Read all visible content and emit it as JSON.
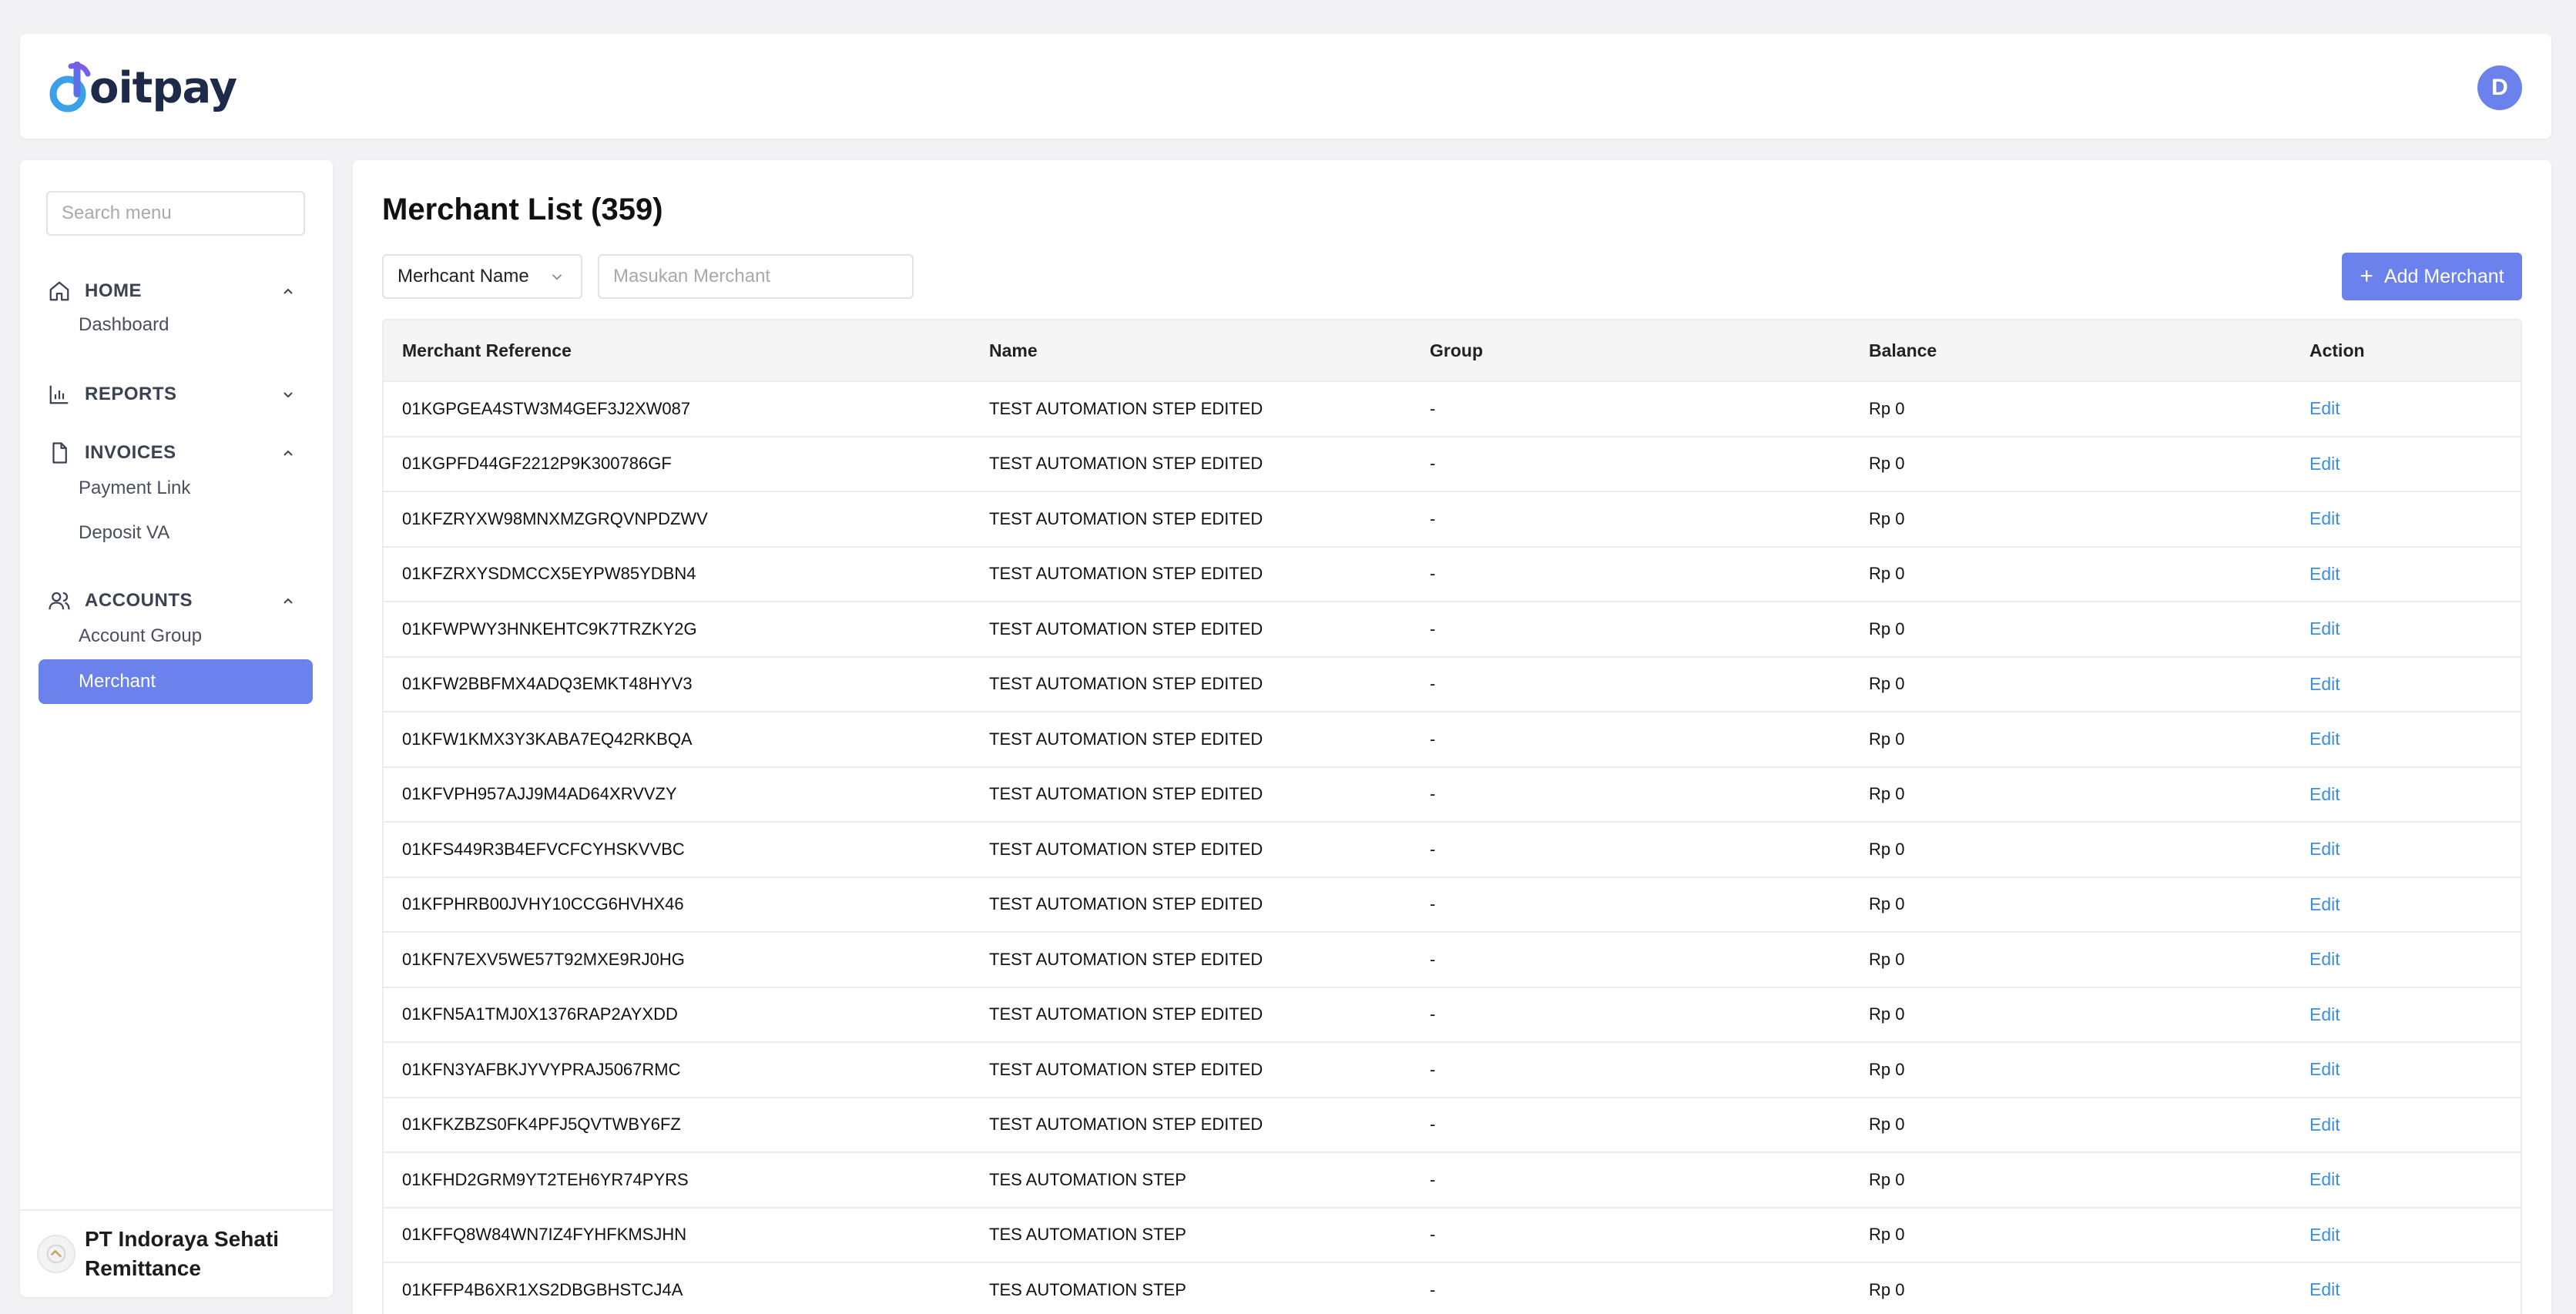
{
  "brand": {
    "logo_text": "oitpay",
    "accent": "#6b82ec"
  },
  "user": {
    "avatar_initial": "D"
  },
  "sidebar": {
    "search_placeholder": "Search menu",
    "sections": [
      {
        "label": "HOME",
        "icon": "home-icon",
        "expanded": true,
        "items": [
          "Dashboard"
        ]
      },
      {
        "label": "REPORTS",
        "icon": "bar-chart-icon",
        "expanded": false,
        "items": []
      },
      {
        "label": "INVOICES",
        "icon": "document-icon",
        "expanded": true,
        "items": [
          "Payment Link",
          "Deposit VA"
        ]
      },
      {
        "label": "ACCOUNTS",
        "icon": "users-icon",
        "expanded": true,
        "items": [
          "Account Group",
          "Merchant"
        ]
      }
    ],
    "active_item": "Merchant",
    "company_name_line1": "PT Indoraya Sehati",
    "company_name_line2": "Remittance"
  },
  "main": {
    "title": "Merchant List (359)",
    "filter_select": "Merhcant Name",
    "filter_placeholder": "Masukan Merchant",
    "add_button": "Add Merchant",
    "columns": [
      "Merchant Reference",
      "Name",
      "Group",
      "Balance",
      "Action"
    ],
    "rows": [
      [
        "01KGPGEA4STW3M4GEF3J2XW087",
        "TEST AUTOMATION STEP EDITED",
        "-",
        "Rp 0",
        "Edit"
      ],
      [
        "01KGPFD44GF2212P9K300786GF",
        "TEST AUTOMATION STEP EDITED",
        "-",
        "Rp 0",
        "Edit"
      ],
      [
        "01KFZRYXW98MNXMZGRQVNPDZWV",
        "TEST AUTOMATION STEP EDITED",
        "-",
        "Rp 0",
        "Edit"
      ],
      [
        "01KFZRXYSDMCCX5EYPW85YDBN4",
        "TEST AUTOMATION STEP EDITED",
        "-",
        "Rp 0",
        "Edit"
      ],
      [
        "01KFWPWY3HNKEHTC9K7TRZKY2G",
        "TEST AUTOMATION STEP EDITED",
        "-",
        "Rp 0",
        "Edit"
      ],
      [
        "01KFW2BBFMX4ADQ3EMKT48HYV3",
        "TEST AUTOMATION STEP EDITED",
        "-",
        "Rp 0",
        "Edit"
      ],
      [
        "01KFW1KMX3Y3KABA7EQ42RKBQA",
        "TEST AUTOMATION STEP EDITED",
        "-",
        "Rp 0",
        "Edit"
      ],
      [
        "01KFVPH957AJJ9M4AD64XRVVZY",
        "TEST AUTOMATION STEP EDITED",
        "-",
        "Rp 0",
        "Edit"
      ],
      [
        "01KFS449R3B4EFVCFCYHSKVVBC",
        "TEST AUTOMATION STEP EDITED",
        "-",
        "Rp 0",
        "Edit"
      ],
      [
        "01KFPHRB00JVHY10CCG6HVHX46",
        "TEST AUTOMATION STEP EDITED",
        "-",
        "Rp 0",
        "Edit"
      ],
      [
        "01KFN7EXV5WE57T92MXE9RJ0HG",
        "TEST AUTOMATION STEP EDITED",
        "-",
        "Rp 0",
        "Edit"
      ],
      [
        "01KFN5A1TMJ0X1376RAP2AYXDD",
        "TEST AUTOMATION STEP EDITED",
        "-",
        "Rp 0",
        "Edit"
      ],
      [
        "01KFN3YAFBKJYVYPRAJ5067RMC",
        "TEST AUTOMATION STEP EDITED",
        "-",
        "Rp 0",
        "Edit"
      ],
      [
        "01KFKZBZS0FK4PFJ5QVTWBY6FZ",
        "TEST AUTOMATION STEP EDITED",
        "-",
        "Rp 0",
        "Edit"
      ],
      [
        "01KFHD2GRM9YT2TEH6YR74PYRS",
        "TES AUTOMATION STEP",
        "-",
        "Rp 0",
        "Edit"
      ],
      [
        "01KFFQ8W84WN7IZ4FYHFKMSJHN",
        "TES AUTOMATION STEP",
        "-",
        "Rp 0",
        "Edit"
      ],
      [
        "01KFFP4B6XR1XS2DBGBHSTCJ4A",
        "TES AUTOMATION STEP",
        "-",
        "Rp 0",
        "Edit"
      ]
    ]
  }
}
